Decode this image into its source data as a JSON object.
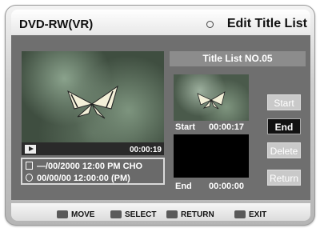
{
  "header": {
    "device": "DVD-RW(VR)",
    "screen_title": "Edit Title List"
  },
  "player": {
    "time": "00:00:19",
    "title_info": "—/00/2000 12:00 PM CHO",
    "duration_info": "00/00/00 12:00:00 (PM)"
  },
  "title_list": {
    "header": "Title List NO.05",
    "start_label": "Start",
    "start_time": "00:00:17",
    "end_label": "End",
    "end_time": "00:00:00"
  },
  "buttons": {
    "start": "Start",
    "end": "End",
    "delete": "Delete",
    "return": "Return"
  },
  "footer": {
    "move": "MOVE",
    "select": "SELECT",
    "return": "RETURN",
    "exit": "EXIT"
  }
}
